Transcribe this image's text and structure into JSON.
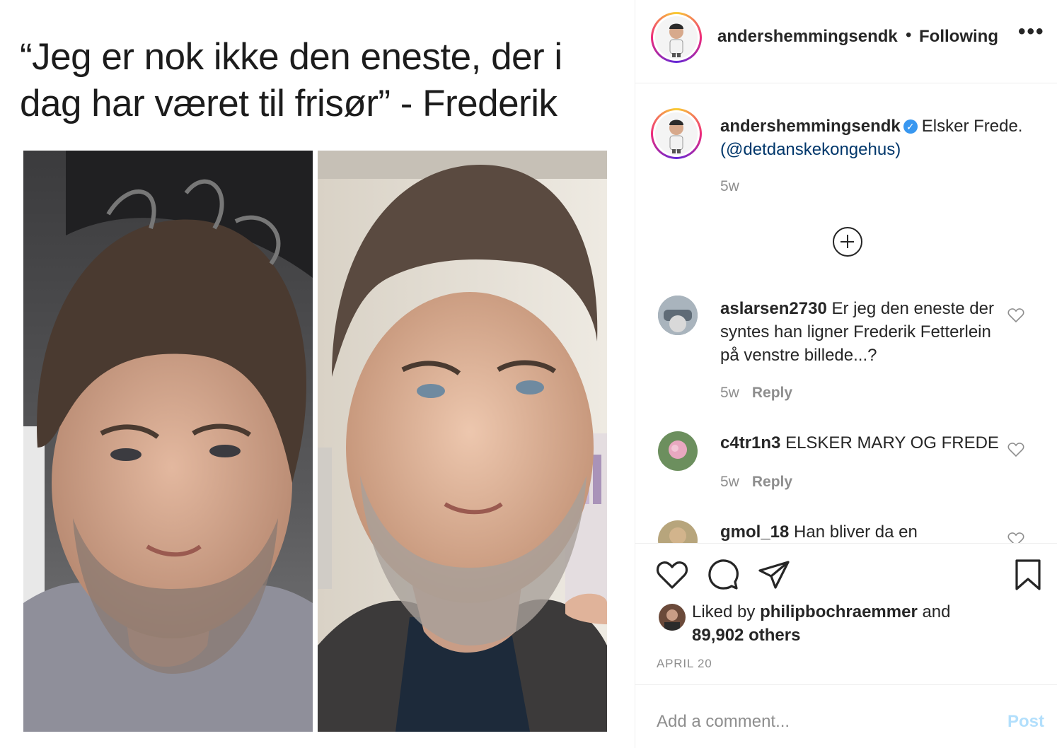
{
  "media": {
    "quote": "“Jeg er nok ikke den eneste, der i dag har været til frisør” - Frederik"
  },
  "header": {
    "username": "andershemmingsendk",
    "separator": "•",
    "follow_status": "Following",
    "more": "•••"
  },
  "caption": {
    "username": "andershemmingsendk",
    "verified_icon": "verified-badge-icon",
    "text": "Elsker Frede.",
    "mention": "(@detdanskekongehus)",
    "age": "5w"
  },
  "load_more_icon": "plus-circle-icon",
  "comments": [
    {
      "username": "aslarsen2730",
      "text": "Er jeg den eneste der syntes han ligner Frederik Fetterlein på venstre billede...?",
      "age": "5w",
      "reply": "Reply"
    },
    {
      "username": "c4tr1n3",
      "text": "ELSKER MARY OG FREDE",
      "age": "5w",
      "reply": "Reply"
    },
    {
      "username": "gmol_18",
      "text": "Han bliver da en"
    }
  ],
  "actions": {
    "like_icon": "heart-icon",
    "comment_icon": "comment-bubble-icon",
    "share_icon": "paper-plane-icon",
    "save_icon": "bookmark-icon"
  },
  "likes": {
    "prefix": "Liked by",
    "user": "philipbochraemmer",
    "and": "and",
    "count": "89,902 others"
  },
  "date": "APRIL 20",
  "composer": {
    "placeholder": "Add a comment...",
    "post": "Post"
  }
}
